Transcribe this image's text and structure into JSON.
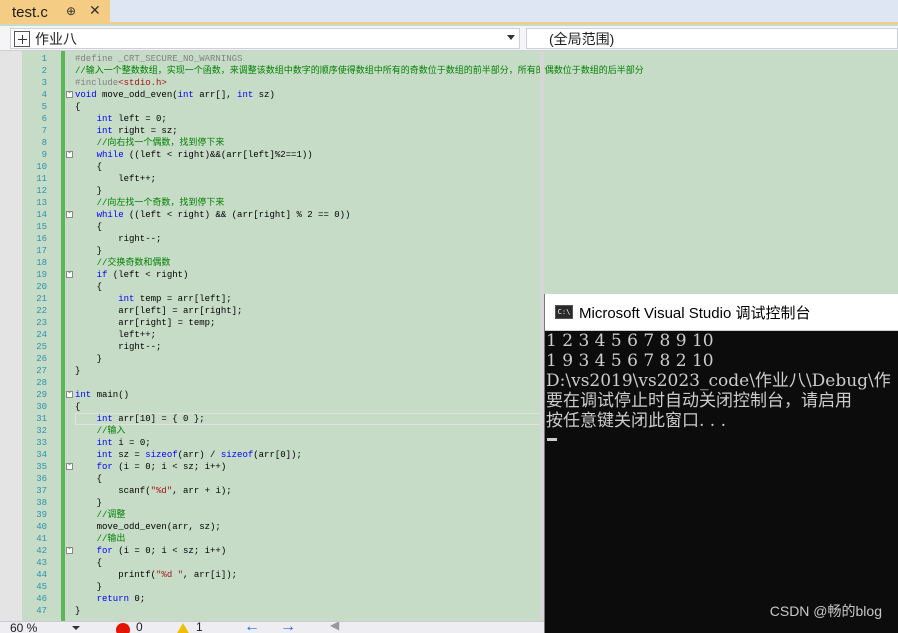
{
  "tab": {
    "title": "test.c",
    "pin_glyph": "⊕",
    "close_glyph": "✕"
  },
  "nav": {
    "scope": "作业八",
    "global": "(全局范围)"
  },
  "code_lines": [
    {
      "n": "1",
      "fold": "",
      "html": "<span class=\"pp\">#define _CRT_SECURE_NO_WARNINGS</span>"
    },
    {
      "n": "2",
      "fold": "",
      "html": "<span class=\"cm\">//输入一个整数数组，实现一个函数，来调整该数组中数字的顺序使得数组中所有的奇数位于数组的前半部分，所有的偶数位于数组的后半部分</span>"
    },
    {
      "n": "3",
      "fold": "",
      "html": "<span class=\"pp\">#include</span><span class=\"st\">&lt;stdio.h&gt;</span>"
    },
    {
      "n": "4",
      "fold": "-",
      "html": "<span class=\"kw\">void</span> move_odd_even(<span class=\"kw\">int</span> arr[], <span class=\"kw\">int</span> sz)"
    },
    {
      "n": "5",
      "fold": "",
      "html": "{"
    },
    {
      "n": "6",
      "fold": "",
      "html": "    <span class=\"kw\">int</span> left = 0;"
    },
    {
      "n": "7",
      "fold": "",
      "html": "    <span class=\"kw\">int</span> right = sz;"
    },
    {
      "n": "8",
      "fold": "",
      "html": "    <span class=\"cm\">//向右找一个偶数，找到停下来</span>"
    },
    {
      "n": "9",
      "fold": "-",
      "html": "    <span class=\"kw\">while</span> ((left &lt; right)&amp;&amp;(arr[left]%2==1))"
    },
    {
      "n": "10",
      "fold": "",
      "html": "    {"
    },
    {
      "n": "11",
      "fold": "",
      "html": "        left++;"
    },
    {
      "n": "12",
      "fold": "",
      "html": "    }"
    },
    {
      "n": "13",
      "fold": "",
      "html": "    <span class=\"cm\">//向左找一个奇数，找到停下来</span>"
    },
    {
      "n": "14",
      "fold": "-",
      "html": "    <span class=\"kw\">while</span> ((left &lt; right) &amp;&amp; (arr[right] % 2 == 0))"
    },
    {
      "n": "15",
      "fold": "",
      "html": "    {"
    },
    {
      "n": "16",
      "fold": "",
      "html": "        right--;"
    },
    {
      "n": "17",
      "fold": "",
      "html": "    }"
    },
    {
      "n": "18",
      "fold": "",
      "html": "    <span class=\"cm\">//交换奇数和偶数</span>"
    },
    {
      "n": "19",
      "fold": "-",
      "html": "    <span class=\"kw\">if</span> (left &lt; right)"
    },
    {
      "n": "20",
      "fold": "",
      "html": "    {"
    },
    {
      "n": "21",
      "fold": "",
      "html": "        <span class=\"kw\">int</span> temp = arr[left];"
    },
    {
      "n": "22",
      "fold": "",
      "html": "        arr[left] = arr[right];"
    },
    {
      "n": "23",
      "fold": "",
      "html": "        arr[right] = temp;"
    },
    {
      "n": "24",
      "fold": "",
      "html": "        left++;"
    },
    {
      "n": "25",
      "fold": "",
      "html": "        right--;"
    },
    {
      "n": "26",
      "fold": "",
      "html": "    }"
    },
    {
      "n": "27",
      "fold": "",
      "html": "}"
    },
    {
      "n": "28",
      "fold": "",
      "html": ""
    },
    {
      "n": "29",
      "fold": "-",
      "html": "<span class=\"kw\">int</span> main()"
    },
    {
      "n": "30",
      "fold": "",
      "html": "{"
    },
    {
      "n": "31",
      "fold": "",
      "html": "    <span class=\"kw\">int</span> arr[10] = { 0 };"
    },
    {
      "n": "32",
      "fold": "",
      "html": "    <span class=\"cm\">//输入</span>"
    },
    {
      "n": "33",
      "fold": "",
      "html": "    <span class=\"kw\">int</span> i = 0;"
    },
    {
      "n": "34",
      "fold": "",
      "html": "    <span class=\"kw\">int</span> sz = <span class=\"kw\">sizeof</span>(arr) / <span class=\"kw\">sizeof</span>(arr[0]);"
    },
    {
      "n": "35",
      "fold": "-",
      "html": "    <span class=\"kw\">for</span> (i = 0; i &lt; sz; i++)"
    },
    {
      "n": "36",
      "fold": "",
      "html": "    {"
    },
    {
      "n": "37",
      "fold": "",
      "html": "        scanf(<span class=\"st\">\"%d\"</span>, arr + i);"
    },
    {
      "n": "38",
      "fold": "",
      "html": "    }"
    },
    {
      "n": "39",
      "fold": "",
      "html": "    <span class=\"cm\">//调整</span>"
    },
    {
      "n": "40",
      "fold": "",
      "html": "    move_odd_even(arr, sz);"
    },
    {
      "n": "41",
      "fold": "",
      "html": "    <span class=\"cm\">//输出</span>"
    },
    {
      "n": "42",
      "fold": "-",
      "html": "    <span class=\"kw\">for</span> (i = 0; i &lt; sz; i++)"
    },
    {
      "n": "43",
      "fold": "",
      "html": "    {"
    },
    {
      "n": "44",
      "fold": "",
      "html": "        printf(<span class=\"st\">\"%d \"</span>, arr[i]);"
    },
    {
      "n": "45",
      "fold": "",
      "html": "    }"
    },
    {
      "n": "46",
      "fold": "",
      "html": "    <span class=\"kw\">return</span> 0;"
    },
    {
      "n": "47",
      "fold": "",
      "html": "}"
    }
  ],
  "console": {
    "title": "Microsoft Visual Studio 调试控制台",
    "icon_text": "C:\\",
    "lines": [
      "1 2 3 4 5 6 7 8 9 10",
      "1 9 3 4 5 6 7 8 2 10",
      "D:\\vs2019\\vs2023_code\\作业八\\Debug\\作",
      "要在调试停止时自动关闭控制台，请启用",
      "按任意键关闭此窗口. . ."
    ]
  },
  "watermark": "CSDN @畅的blog",
  "status": {
    "zoom": "60 %",
    "errors": "0",
    "warnings": "1",
    "back_glyph": "←",
    "fwd_glyph": "→",
    "more_glyph": "◀"
  }
}
